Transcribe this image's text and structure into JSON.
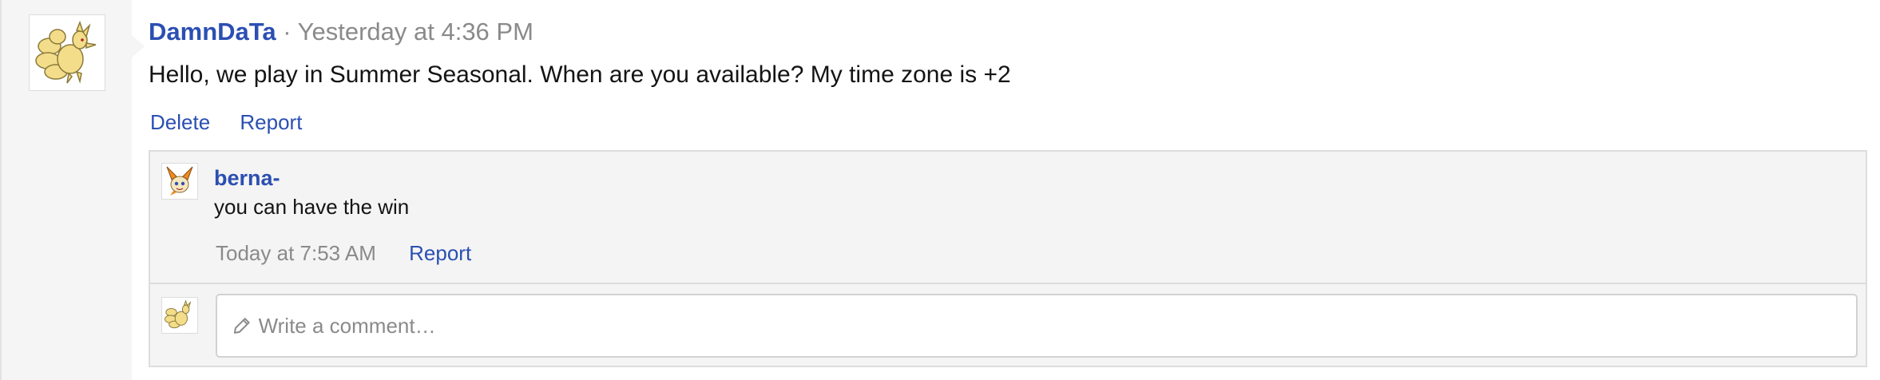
{
  "post": {
    "author": "DamnDaTa",
    "separator": "·",
    "timestamp": "Yesterday at 4:36 PM",
    "body": "Hello, we play in Summer Seasonal. When are you available? My time zone is +2",
    "actions": {
      "delete": "Delete",
      "report": "Report"
    },
    "avatar_icon": "ninetales-avatar"
  },
  "comments": [
    {
      "author": "berna-",
      "text": "you can have the win",
      "timestamp": "Today at 7:53 AM",
      "report": "Report",
      "avatar_icon": "victini-avatar"
    }
  ],
  "reply": {
    "placeholder": "Write a comment…",
    "icon": "pencil-icon",
    "avatar_icon": "ninetales-avatar"
  },
  "colors": {
    "link": "#2b4fb2",
    "muted": "#8a8a8a",
    "panel": "#f4f4f4"
  }
}
